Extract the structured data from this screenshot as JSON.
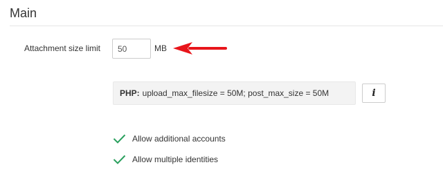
{
  "section": {
    "title": "Main"
  },
  "attachment": {
    "label": "Attachment size limit",
    "value": "50",
    "unit": "MB"
  },
  "php_notice": {
    "prefix": "PHP:",
    "text": "upload_max_filesize = 50M; post_max_size = 50M"
  },
  "info_button": {
    "label": "i"
  },
  "options": [
    {
      "label": "Allow additional accounts",
      "checked": true
    },
    {
      "label": "Allow multiple identities",
      "checked": true
    }
  ],
  "colors": {
    "annotation_arrow": "#e8151b",
    "check": "#2aa05e"
  }
}
